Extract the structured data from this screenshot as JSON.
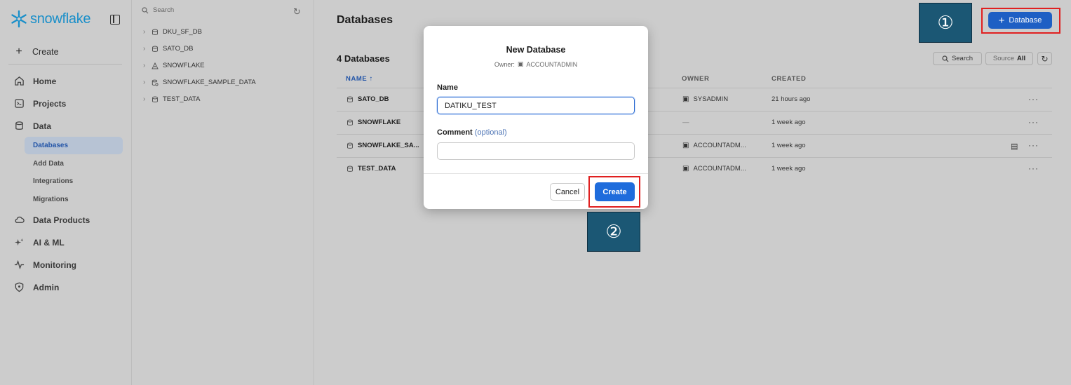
{
  "sidebar": {
    "logo_text": "snowflake",
    "create_label": "Create",
    "nav": [
      {
        "label": "Home"
      },
      {
        "label": "Projects"
      },
      {
        "label": "Data"
      },
      {
        "label": "Data Products"
      },
      {
        "label": "AI & ML"
      },
      {
        "label": "Monitoring"
      },
      {
        "label": "Admin"
      }
    ],
    "data_sub": [
      {
        "label": "Databases",
        "active": true
      },
      {
        "label": "Add Data"
      },
      {
        "label": "Integrations"
      },
      {
        "label": "Migrations"
      }
    ]
  },
  "tree": {
    "search_placeholder": "Search",
    "items": [
      {
        "label": "DKU_SF_DB",
        "icon": "database-icon"
      },
      {
        "label": "SATO_DB",
        "icon": "database-icon"
      },
      {
        "label": "SNOWFLAKE",
        "icon": "shared-database-icon"
      },
      {
        "label": "SNOWFLAKE_SAMPLE_DATA",
        "icon": "sample-database-icon"
      },
      {
        "label": "TEST_DATA",
        "icon": "database-icon"
      }
    ]
  },
  "main": {
    "title": "Databases",
    "add_button": "Database",
    "count_title": "4 Databases",
    "search_button": "Search",
    "source_label": "Source",
    "source_value": "All",
    "columns": {
      "name": "NAME",
      "owner": "OWNER",
      "created": "CREATED"
    },
    "rows": [
      {
        "name": "SATO_DB",
        "owner": "SYSADMIN",
        "created": "21 hours ago"
      },
      {
        "name": "SNOWFLAKE",
        "owner": "—",
        "created": "1 week ago"
      },
      {
        "name": "SNOWFLAKE_SA...",
        "owner": "ACCOUNTADM...",
        "created": "1 week ago"
      },
      {
        "name": "TEST_DATA",
        "owner": "ACCOUNTADM...",
        "created": "1 week ago"
      }
    ]
  },
  "modal": {
    "title": "New Database",
    "owner_label": "Owner:",
    "owner_value": "ACCOUNTADMIN",
    "name_label": "Name",
    "name_value": "DATIKU_TEST",
    "comment_label": "Comment",
    "comment_optional": "(optional)",
    "comment_value": "",
    "cancel_label": "Cancel",
    "create_label": "Create"
  },
  "annotations": {
    "step1": "①",
    "step2": "②",
    "highlight_color": "#e02020",
    "badge_color": "#1b5774"
  },
  "colors": {
    "accent": "#1e6cdc",
    "brand": "#1a8fc9"
  }
}
